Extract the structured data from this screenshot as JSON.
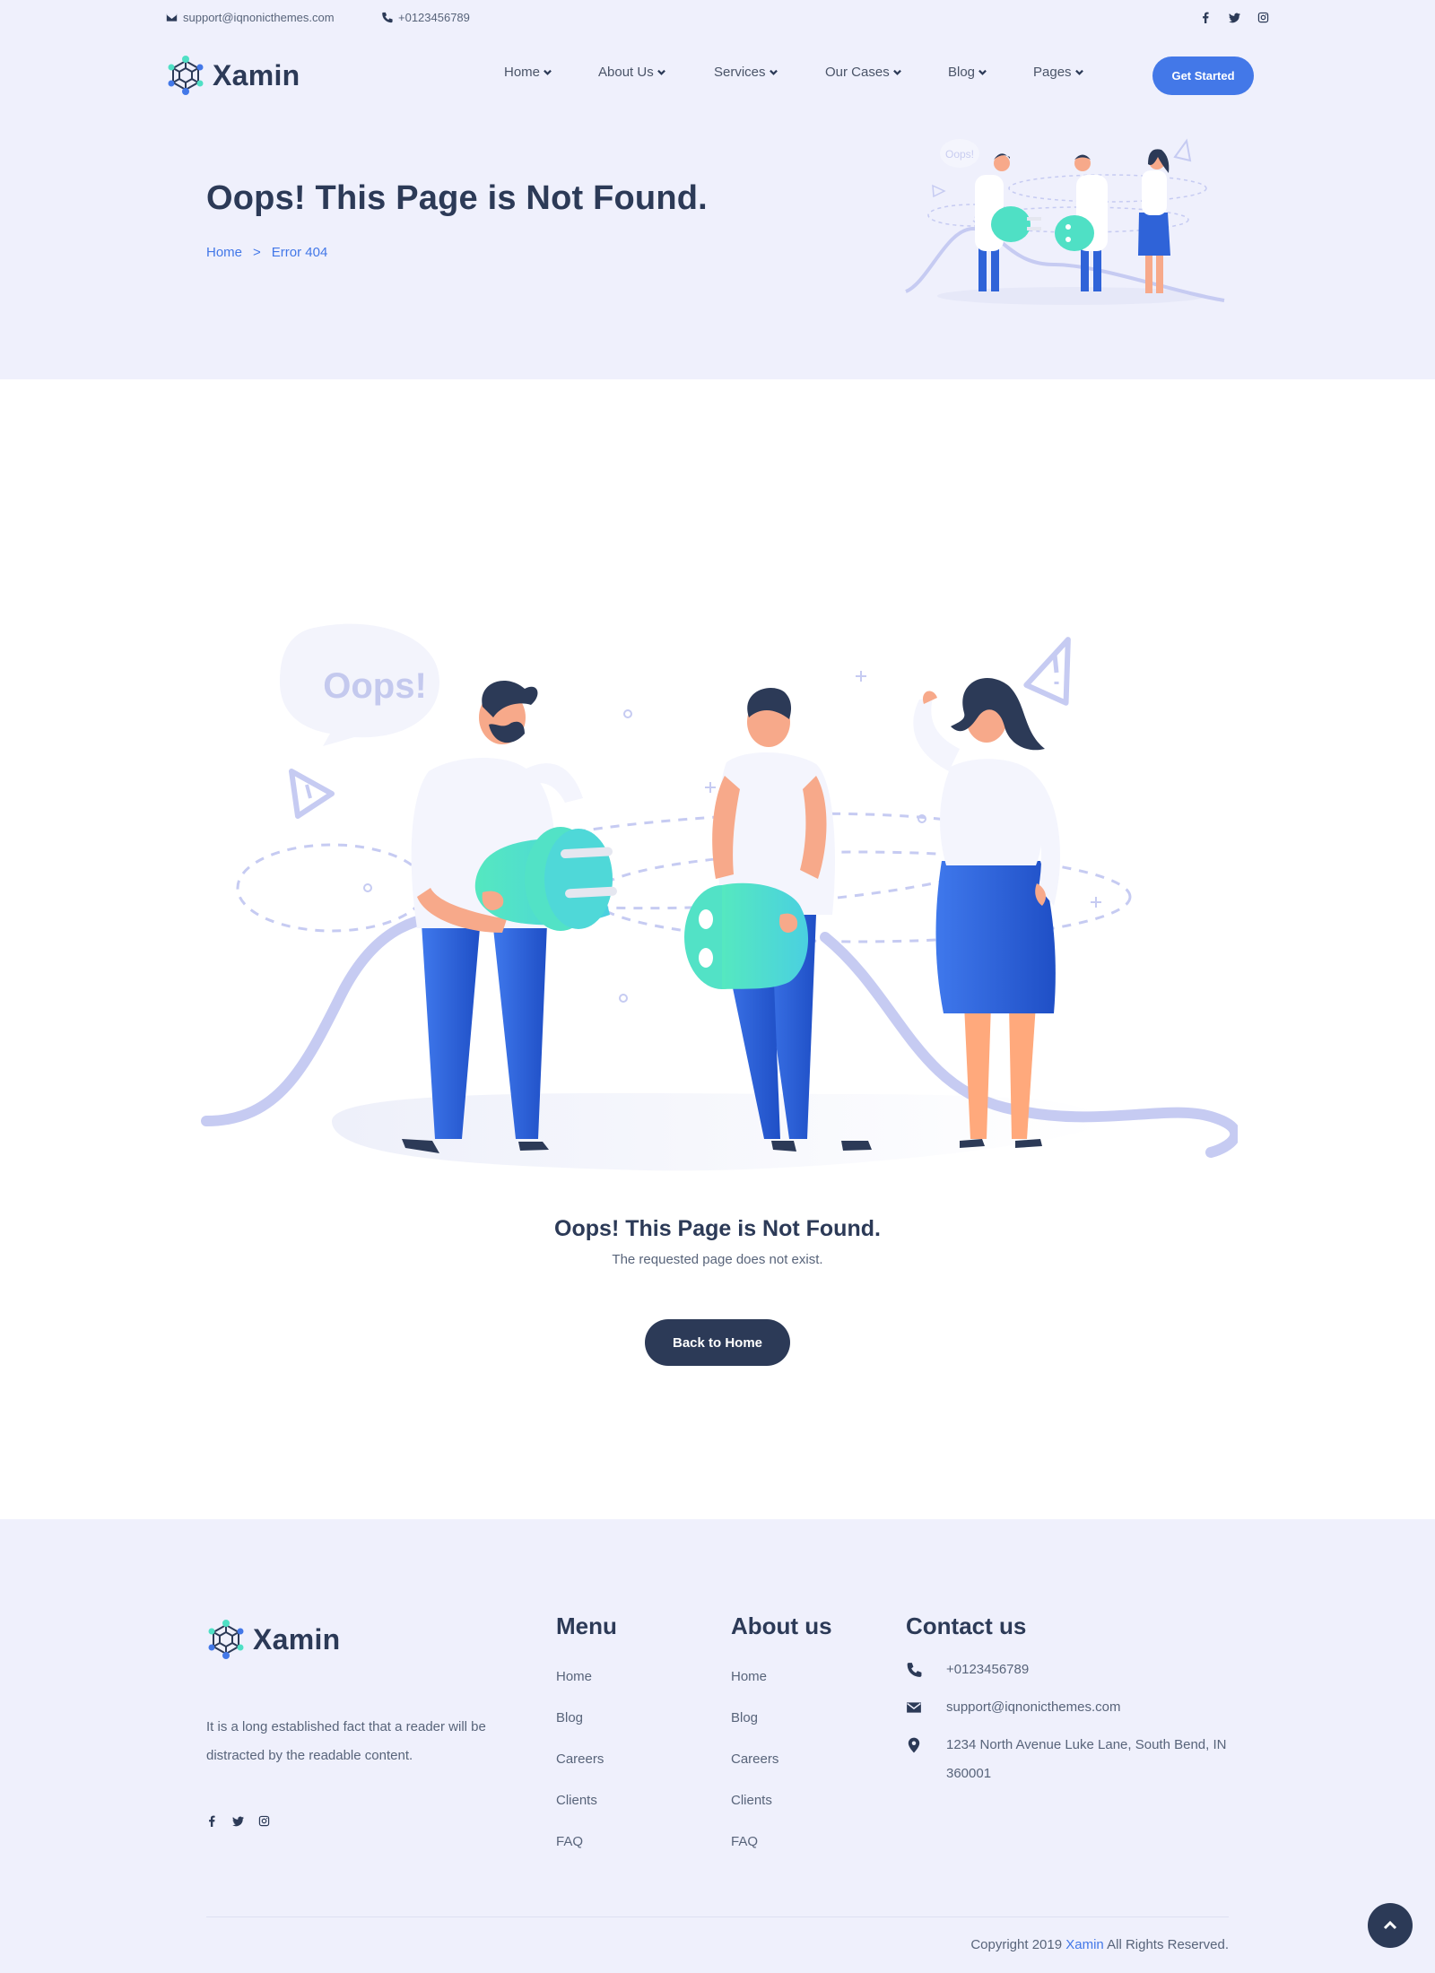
{
  "topbar": {
    "email": "support@iqnonicthemes.com",
    "phone": "+0123456789",
    "social": [
      "facebook-icon",
      "twitter-icon",
      "instagram-icon"
    ]
  },
  "header": {
    "brand": "Xamin",
    "nav": [
      {
        "label": "Home"
      },
      {
        "label": "About Us"
      },
      {
        "label": "Services"
      },
      {
        "label": "Our Cases"
      },
      {
        "label": "Blog"
      },
      {
        "label": "Pages"
      }
    ],
    "cta_label": "Get Started"
  },
  "hero": {
    "title": "Oops! This Page is Not Found.",
    "breadcrumb": {
      "home": "Home",
      "separator": ">",
      "current": "Error 404"
    },
    "bubble_text": "Oops!"
  },
  "main": {
    "bubble_text": "Oops!",
    "title": "Oops! This Page is Not Found.",
    "subtitle": "The requested page does not exist.",
    "button_label": "Back to Home"
  },
  "footer": {
    "brand": "Xamin",
    "description": "It is a long established fact that a reader will be distracted by the readable content.",
    "menu": {
      "heading": "Menu",
      "links": [
        "Home",
        "Blog",
        "Careers",
        "Clients",
        "FAQ"
      ]
    },
    "about": {
      "heading": "About us",
      "links": [
        "Home",
        "Blog",
        "Careers",
        "Clients",
        "FAQ"
      ]
    },
    "contact": {
      "heading": "Contact us",
      "phone": "+0123456789",
      "email": "support@iqnonicthemes.com",
      "address": "1234 North Avenue Luke Lane, South Bend, IN 360001"
    },
    "copyright_prefix": "Copyright 2019",
    "copyright_brand": "Xamin",
    "copyright_suffix": "All Rights Reserved."
  },
  "colors": {
    "accent": "#4378e8",
    "dark": "#2c3a57",
    "band": "#eff0fc",
    "plug": "#4fe0c5",
    "pants": "#2f63d8"
  }
}
